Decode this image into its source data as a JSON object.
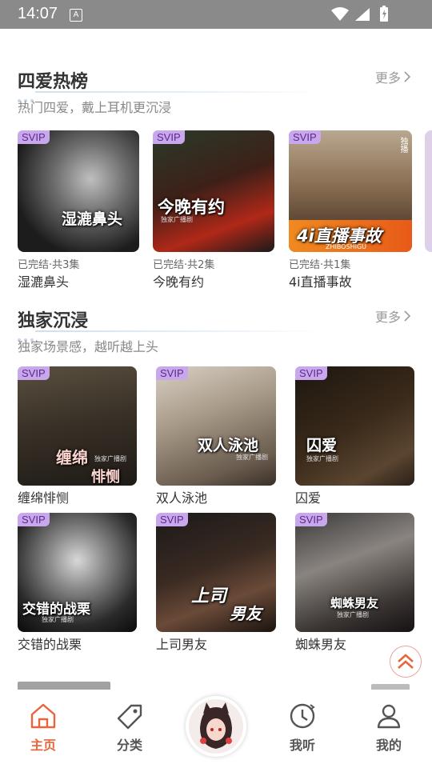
{
  "status_bar": {
    "time": "14:07",
    "a_icon": "A"
  },
  "sections": {
    "hot": {
      "title": "四爱热榜",
      "subtitle": "热门四爱，戴上耳机更沉浸",
      "more": "更多",
      "items": [
        {
          "badge": "SVIP",
          "status": "已完结·共3集",
          "title": "湿漉鼻头",
          "cover_text": "湿漉鼻头"
        },
        {
          "badge": "SVIP",
          "status": "已完结·共2集",
          "title": "今晚有约",
          "cover_text": "今晚有约",
          "cover_sub": "独家广播剧"
        },
        {
          "badge": "SVIP",
          "status": "已完结·共1集",
          "title": "4i直播事故",
          "cover_text": "4i直播事故",
          "cover_sub": "ZHIBOSHIGU",
          "side_badge": "独播"
        }
      ]
    },
    "exclusive": {
      "title": "独家沉浸",
      "subtitle": "独家场景感，越听越上头",
      "more": "更多",
      "items": [
        {
          "badge": "SVIP",
          "title": "缠绵悱恻",
          "cover_text_1": "缠绵",
          "cover_text_2": "悱恻",
          "cover_sub": "独家广播剧"
        },
        {
          "badge": "SVIP",
          "title": "双人泳池",
          "cover_text": "双人泳池",
          "cover_sub": "独家广播剧"
        },
        {
          "badge": "SVIP",
          "title": "囚爱",
          "cover_text": "囚爱",
          "cover_sub": "独家广播剧"
        },
        {
          "badge": "SVIP",
          "title": "交错的战栗",
          "cover_text": "交错的战栗",
          "cover_sub": "独家广播剧"
        },
        {
          "badge": "SVIP",
          "title": "上司男友",
          "cover_text_1": "上司",
          "cover_text_2": "男友"
        },
        {
          "badge": "SVIP",
          "title": "蜘蛛男友",
          "cover_text": "蜘蛛男友",
          "cover_sub": "独家广播剧"
        }
      ]
    }
  },
  "tab_bar": {
    "home": "主页",
    "category": "分类",
    "listened": "我听",
    "mine": "我的"
  },
  "colors": {
    "accent": "#e8663c",
    "svip_bg": "#c9a7ec",
    "status_bar": "#8a8a8a"
  },
  "icons": [
    "home-icon",
    "tag-icon",
    "avatar-icon",
    "history-icon",
    "user-icon",
    "double-chevron-up-icon",
    "wifi-icon",
    "signal-icon",
    "battery-icon"
  ]
}
